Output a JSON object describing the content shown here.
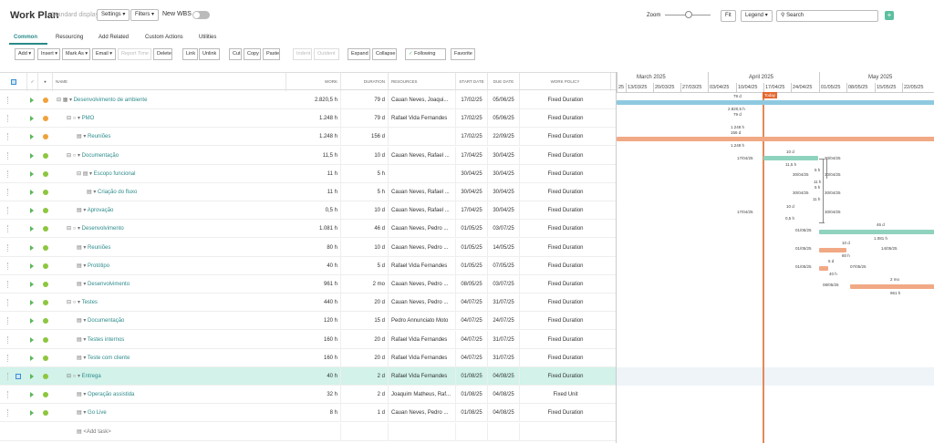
{
  "header": {
    "title": "Work Plan",
    "subtitle": "Standard display",
    "settings_label": "Settings ▾",
    "filters_label": "Filters ▾",
    "new_wbs_label": "New WBS",
    "zoom_label": "Zoom",
    "fit_label": "Fit",
    "legend_label": "Legend ▾",
    "search_placeholder": "Search",
    "plus_label": "+"
  },
  "tabs": [
    "Common",
    "Resourcing",
    "Add Related",
    "Custom Actions",
    "Utilities"
  ],
  "toolbar": [
    "Add ▾",
    "Insert ▾",
    "Mark As ▾",
    "Email ▾",
    "Report Time",
    "Delete",
    "Link",
    "Unlink",
    "Cut",
    "Copy",
    "Paste",
    "Indent",
    "Outdent",
    "Expand",
    "Collapse",
    "Following",
    "Favorite"
  ],
  "columns": {
    "name": "NAME",
    "work": "WORK",
    "duration": "DURATION",
    "resources": "RESOURCES",
    "start": "START DATE",
    "due": "DUE DATE",
    "policy": "WORK POLICY"
  },
  "rows": [
    {
      "prefix": "⊟ ▦ ▾",
      "name": "Desenvolvimento de ambiente",
      "work": "2.820,5 h",
      "duration": "79 d",
      "resources": "Cauan Neves, Joaqui...",
      "start": "17/02/25",
      "due": "05/06/25",
      "policy": "Fixed Duration",
      "status": "#f0a23a",
      "indent": 0
    },
    {
      "prefix": "⊟ ○ ▾",
      "name": "PMO",
      "work": "1.248 h",
      "duration": "79 d",
      "resources": "Rafael Vida Fernandes",
      "start": "17/02/25",
      "due": "05/06/25",
      "policy": "Fixed Duration",
      "status": "#f0a23a",
      "indent": 1
    },
    {
      "prefix": "▤ ▾",
      "name": "Reuniões",
      "work": "1.248 h",
      "duration": "156 d",
      "resources": "",
      "start": "17/02/25",
      "due": "22/09/25",
      "policy": "Fixed Duration",
      "status": "#f0a23a",
      "indent": 2
    },
    {
      "prefix": "⊟ ○ ▾",
      "name": "Documentação",
      "work": "11,5 h",
      "duration": "10 d",
      "resources": "Cauan Neves, Rafael ...",
      "start": "17/04/25",
      "due": "30/04/25",
      "policy": "Fixed Duration",
      "status": "#8dc63f",
      "indent": 1
    },
    {
      "prefix": "⊟ ▤ ▾",
      "name": "Escopo funcional",
      "work": "11 h",
      "duration": "5 h",
      "resources": "",
      "start": "30/04/25",
      "due": "30/04/25",
      "policy": "Fixed Duration",
      "status": "#8dc63f",
      "indent": 2
    },
    {
      "prefix": "▤ ▾",
      "name": "Criação do fluxo",
      "work": "11 h",
      "duration": "5 h",
      "resources": "Cauan Neves, Rafael ...",
      "start": "30/04/25",
      "due": "30/04/25",
      "policy": "Fixed Duration",
      "status": "#8dc63f",
      "indent": 3
    },
    {
      "prefix": "▤ ▾",
      "name": "Aprovação",
      "work": "0,5 h",
      "duration": "10 d",
      "resources": "Cauan Neves, Rafael ...",
      "start": "17/04/25",
      "due": "30/04/25",
      "policy": "Fixed Duration",
      "status": "#8dc63f",
      "indent": 2
    },
    {
      "prefix": "⊟ ○ ▾",
      "name": "Desenvolvimento",
      "work": "1.081 h",
      "duration": "46 d",
      "resources": "Cauan Neves, Pedro ...",
      "start": "01/05/25",
      "due": "03/07/25",
      "policy": "Fixed Duration",
      "status": "#8dc63f",
      "indent": 1
    },
    {
      "prefix": "▤ ▾",
      "name": "Reuniões",
      "work": "80 h",
      "duration": "10 d",
      "resources": "Cauan Neves, Pedro ...",
      "start": "01/05/25",
      "due": "14/05/25",
      "policy": "Fixed Duration",
      "status": "#8dc63f",
      "indent": 2
    },
    {
      "prefix": "▤ ▾",
      "name": "Protótipo",
      "work": "40 h",
      "duration": "5 d",
      "resources": "Rafael Vida Fernandes",
      "start": "01/05/25",
      "due": "07/05/25",
      "policy": "Fixed Duration",
      "status": "#8dc63f",
      "indent": 2
    },
    {
      "prefix": "▤ ▾",
      "name": "Desenvolvimento",
      "work": "961 h",
      "duration": "2 mo",
      "resources": "Cauan Neves, Pedro ...",
      "start": "08/05/25",
      "due": "03/07/25",
      "policy": "Fixed Duration",
      "status": "#8dc63f",
      "indent": 2
    },
    {
      "prefix": "⊟ ○ ▾",
      "name": "Testes",
      "work": "440 h",
      "duration": "20 d",
      "resources": "Cauan Neves, Pedro ...",
      "start": "04/07/25",
      "due": "31/07/25",
      "policy": "Fixed Duration",
      "status": "#8dc63f",
      "indent": 1
    },
    {
      "prefix": "▤ ▾",
      "name": "Documentação",
      "work": "120 h",
      "duration": "15 d",
      "resources": "Pedro Annunciato Moto",
      "start": "04/07/25",
      "due": "24/07/25",
      "policy": "Fixed Duration",
      "status": "#8dc63f",
      "indent": 2
    },
    {
      "prefix": "▤ ▾",
      "name": "Testes internos",
      "work": "160 h",
      "duration": "20 d",
      "resources": "Rafael Vida Fernandes",
      "start": "04/07/25",
      "due": "31/07/25",
      "policy": "Fixed Duration",
      "status": "#8dc63f",
      "indent": 2
    },
    {
      "prefix": "▤ ▾",
      "name": "Teste com cliente",
      "work": "160 h",
      "duration": "20 d",
      "resources": "Rafael Vida Fernandes",
      "start": "04/07/25",
      "due": "31/07/25",
      "policy": "Fixed Duration",
      "status": "#8dc63f",
      "indent": 2
    },
    {
      "prefix": "⊟ ○ ▾",
      "name": "Entrega",
      "work": "40 h",
      "duration": "2 d",
      "resources": "Rafael Vida Fernandes",
      "start": "01/08/25",
      "due": "04/08/25",
      "policy": "Fixed Duration",
      "status": "#8dc63f",
      "indent": 1
    },
    {
      "prefix": "▤ ▾",
      "name": "Operação assistida",
      "work": "32 h",
      "duration": "2 d",
      "resources": "Joaquim Matheus, Raf...",
      "start": "01/08/25",
      "due": "04/08/25",
      "policy": "Fixed Unit",
      "status": "#8dc63f",
      "indent": 2
    },
    {
      "prefix": "▤ ▾",
      "name": "Go Live",
      "work": "8 h",
      "duration": "1 d",
      "resources": "Cauan Neves, Pedro ...",
      "start": "01/08/25",
      "due": "04/08/25",
      "policy": "Fixed Duration",
      "status": "#8dc63f",
      "indent": 2
    },
    {
      "prefix": "▤",
      "name": "<Add task>",
      "work": "",
      "duration": "",
      "resources": "",
      "start": "",
      "due": "",
      "policy": "",
      "status": "",
      "indent": 2
    }
  ],
  "gantt": {
    "months": [
      "March 2025",
      "April 2025",
      "May 2025"
    ],
    "weeks": [
      "25",
      "13/03/25",
      "20/03/25",
      "27/03/25",
      "03/04/25",
      "10/04/25",
      "17/04/25",
      "24/04/25",
      "01/05/25",
      "08/05/25",
      "15/05/25",
      "22/05/25"
    ],
    "today_label": "Today",
    "labels": [
      {
        "t": "79 d"
      },
      {
        "t": "2.820,5 h"
      },
      {
        "t": "79 d"
      },
      {
        "t": "1.248 h"
      },
      {
        "t": "156 d"
      },
      {
        "t": "1.248 h"
      },
      {
        "t": "10 d"
      },
      {
        "t": "17/04/25"
      },
      {
        "t": "30/04/25"
      },
      {
        "t": "11,5 h"
      },
      {
        "t": "5 h"
      },
      {
        "t": "30/04/25"
      },
      {
        "t": "30/04/25"
      },
      {
        "t": "11 h"
      },
      {
        "t": "5 h"
      },
      {
        "t": "30/04/25"
      },
      {
        "t": "30/04/25"
      },
      {
        "t": "11 h"
      },
      {
        "t": "10 d"
      },
      {
        "t": "17/04/25"
      },
      {
        "t": "30/04/25"
      },
      {
        "t": "0,5 h"
      },
      {
        "t": "01/05/25"
      },
      {
        "t": "46 d"
      },
      {
        "t": "1.081 h"
      },
      {
        "t": "10 d"
      },
      {
        "t": "01/05/25"
      },
      {
        "t": "14/05/25"
      },
      {
        "t": "80 h"
      },
      {
        "t": "5 d"
      },
      {
        "t": "01/05/25"
      },
      {
        "t": "07/05/25"
      },
      {
        "t": "40 h"
      },
      {
        "t": "08/05/25"
      },
      {
        "t": "2 mo"
      },
      {
        "t": "961 h"
      }
    ]
  },
  "colors": {
    "blue": "#8ec9df",
    "orange": "#f1a985",
    "teal": "#8fd3bf",
    "accent": "#2a8a8a",
    "today": "#e48a5a"
  }
}
